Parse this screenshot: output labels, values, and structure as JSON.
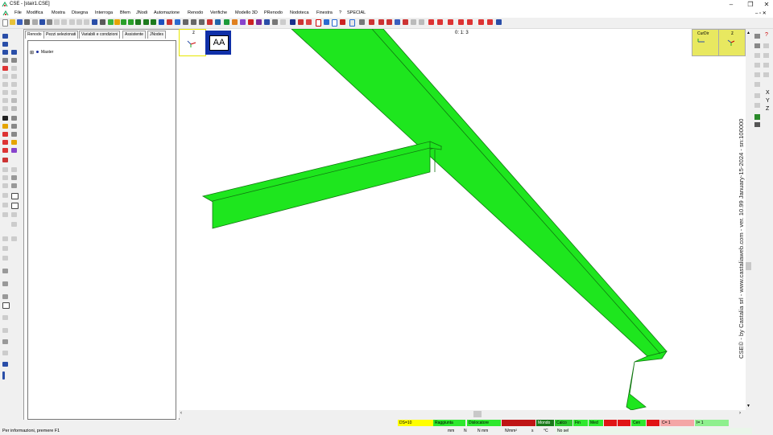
{
  "window": {
    "title": "CSE - [stair1.CSE]"
  },
  "menu": [
    "File",
    "Modifica",
    "Mostra",
    "Disegna",
    "Interroga",
    "Bfem",
    "JNodi",
    "Automazione",
    "Renodo",
    "Verifiche",
    "Modello 3D",
    "PRenodo",
    "Nodoteca",
    "Finestra",
    "?",
    "SPECIAL"
  ],
  "panel": {
    "tabs": [
      "Renodo",
      "Pezzi selezionati",
      "Variabili e condizioni",
      "Assistente",
      "JNodes"
    ],
    "tree": {
      "root_label": "Master",
      "expander": "⊞"
    }
  },
  "viewport": {
    "scale_text": "0: 1: 3",
    "aa_label": "AA",
    "axis_z": "z",
    "curdir_label": "CurDir",
    "axis_widget_z": "z",
    "watermark": "CSE© - by Castalia srl - www.castaliaweb.com - ver. 10.99 January-15-2024 - sn:100000",
    "member_color": "#1ee61e"
  },
  "right_axes": {
    "x": "X",
    "y": "Y",
    "z": "Z"
  },
  "status": {
    "ds": "DS=10",
    "badges": [
      "Raggiunta",
      "Dislocatore",
      "Interpreta",
      "Mondo",
      "Calco",
      "Fin",
      "Med",
      "NEE",
      "Stu",
      "Cen",
      "OK"
    ],
    "c_value": "C= 1",
    "i_value": "I= 1",
    "units": [
      "mm",
      "N",
      "N mm",
      "N/mm²",
      "s",
      "°C",
      "No sel"
    ],
    "help": "Per informazioni, premere F1"
  }
}
